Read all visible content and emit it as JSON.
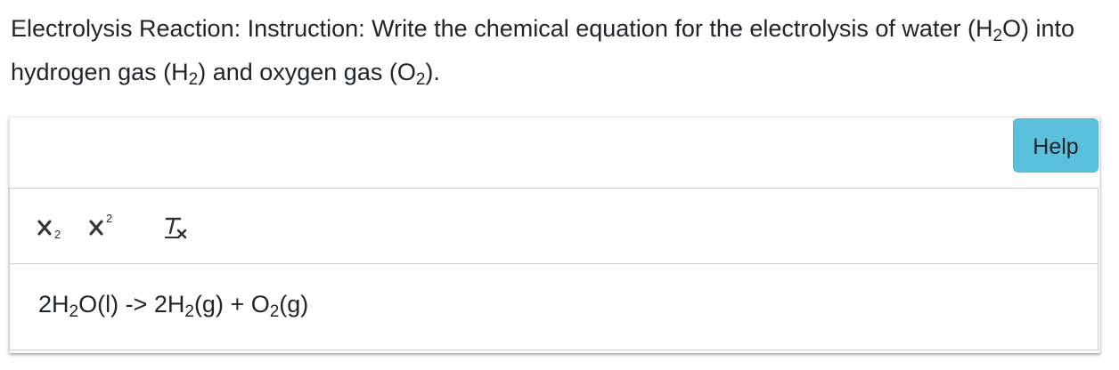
{
  "question": {
    "prefix": "Electrolysis Reaction: Instruction: Write the chemical equation for the electrolysis of water (H",
    "sub1": "2",
    "mid1": "O) into hydrogen gas (H",
    "sub2": "2",
    "mid2": ") and oxygen gas (O",
    "sub3": "2",
    "suffix": ")."
  },
  "help_button": {
    "label": "Help"
  },
  "toolbar": {
    "subscript": {
      "icon": "subscript-icon"
    },
    "superscript": {
      "icon": "superscript-icon"
    },
    "clean": {
      "icon": "clear-formatting-icon"
    }
  },
  "answer": {
    "p1": "2H",
    "s1": "2",
    "p2": "O(l) -> 2H",
    "s2": "2",
    "p3": "(g) + O",
    "s3": "2",
    "p4": "(g)"
  },
  "colors": {
    "help_bg": "#5bc0de",
    "text": "#212529",
    "border": "#cccccc"
  }
}
